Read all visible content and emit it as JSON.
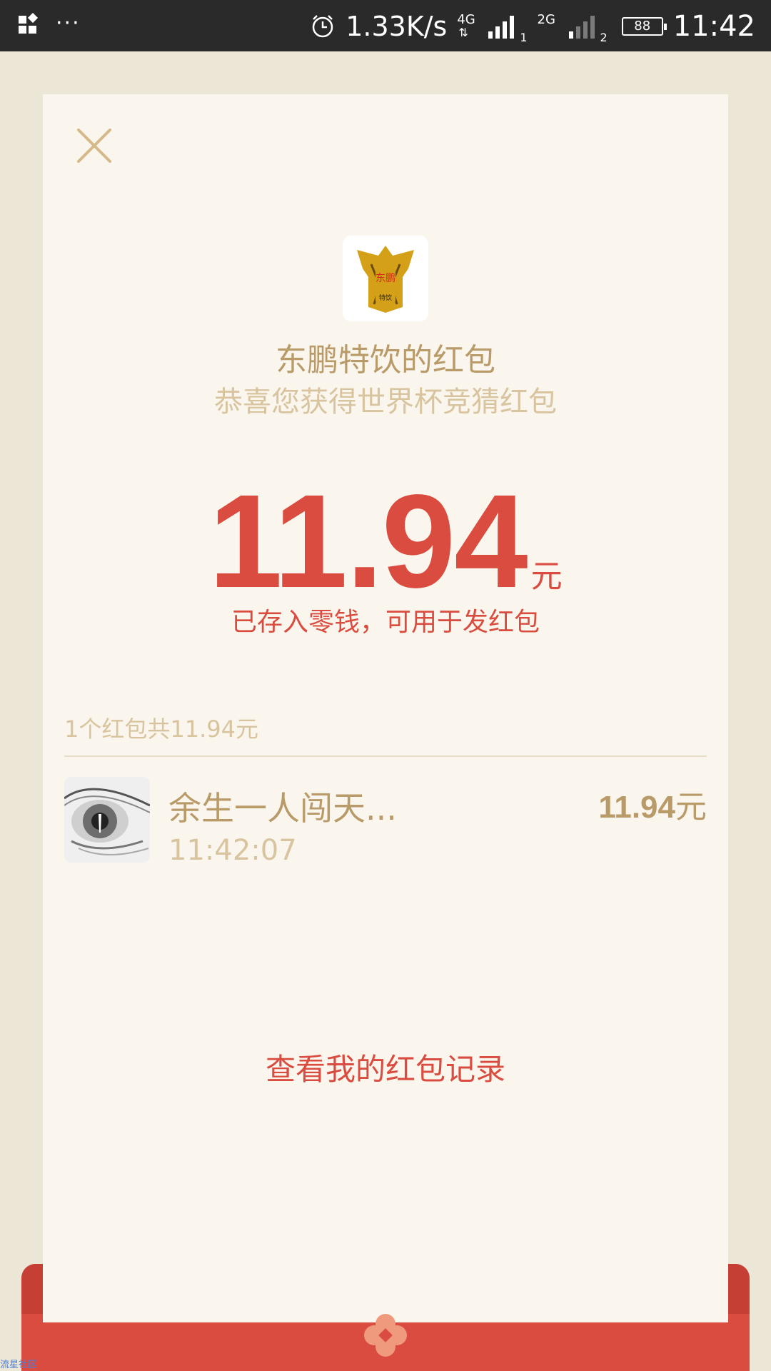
{
  "status_bar": {
    "net_speed": "1.33K/s",
    "sim1_type": "4G",
    "sim1_index": "1",
    "sim2_type": "2G",
    "sim2_index": "2",
    "battery": "88",
    "time": "11:42",
    "icons": [
      "app-switch-icon",
      "more-dots-icon",
      "alarm-icon",
      "signal-icon",
      "battery-icon"
    ]
  },
  "packet": {
    "sender": "东鹏特饮的红包",
    "wish": "恭喜您获得世界杯竞猜红包",
    "logo_text": "东鹏",
    "logo_subtext": "特饮",
    "amount": "11.94",
    "unit": "元",
    "stored_note": "已存入零钱，可用于发红包"
  },
  "summary": "1个红包共11.94元",
  "entries": [
    {
      "name": "余生一人闯天...",
      "time": "11:42:07",
      "amount": "11.94",
      "unit": "元"
    }
  ],
  "records_link": "查看我的红包记录",
  "watermark": "流星社区",
  "colors": {
    "accent_red": "#d94c3f",
    "gold_text": "#b99b6a",
    "light_gold_text": "#d8c49f",
    "card_bg": "#faf6ed",
    "page_bg": "#ece6d6",
    "logo_gold": "#d4a017"
  }
}
